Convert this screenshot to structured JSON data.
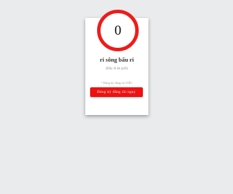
{
  "counter": {
    "value": "0"
  },
  "card": {
    "title": "ri sông bấu ri",
    "subtitle": "(Đây là tài giới)",
    "note": "* Đăng ký đăng tài VIỆC",
    "button_label": "Đăng ký đăng tài ngay"
  },
  "colors": {
    "background": "#e9ebed",
    "accent": "#ee1c1c",
    "card": "#ffffff"
  }
}
